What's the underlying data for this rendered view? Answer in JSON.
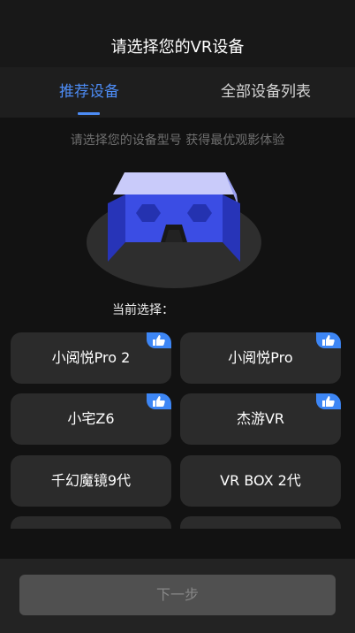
{
  "header": {
    "title": "请选择您的VR设备"
  },
  "tabs": [
    {
      "label": "推荐设备",
      "active": true
    },
    {
      "label": "全部设备列表",
      "active": false
    }
  ],
  "hint": "请选择您的设备型号  获得最优观影体验",
  "current_selection_label": "当前选择：",
  "devices": [
    {
      "name": "小阅悦Pro 2",
      "recommended": true
    },
    {
      "name": "小阅悦Pro",
      "recommended": true
    },
    {
      "name": "小宅Z6",
      "recommended": true
    },
    {
      "name": "杰游VR",
      "recommended": true
    },
    {
      "name": "千幻魔镜9代",
      "recommended": false
    },
    {
      "name": "VR BOX 2代",
      "recommended": false
    },
    {
      "name": "",
      "recommended": false
    },
    {
      "name": "",
      "recommended": false
    }
  ],
  "footer": {
    "next_label": "下一步"
  },
  "icons": {
    "badge": "thumbs-up-icon",
    "device": "vr-headset-icon"
  },
  "colors": {
    "accent": "#4d8cf5",
    "badge": "#3d86f5",
    "background": "#121212"
  }
}
